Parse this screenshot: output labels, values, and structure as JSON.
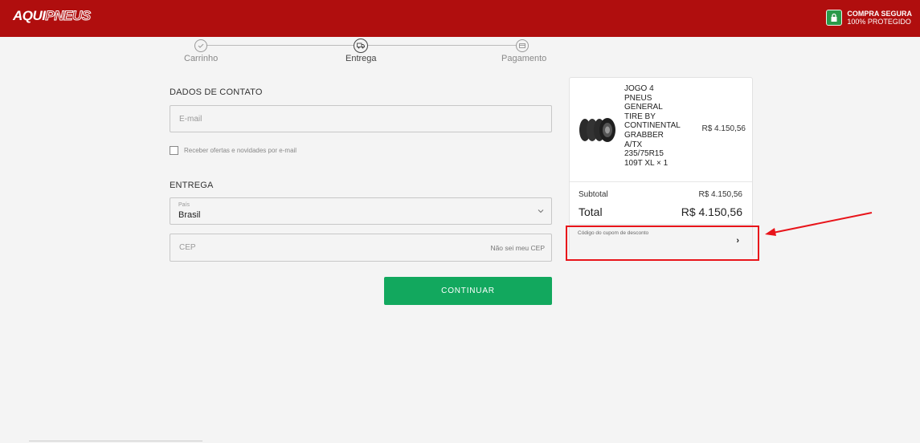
{
  "header": {
    "logo_part1": "AQUI",
    "logo_part2": "PNEUS",
    "secure_line1": "COMPRA SEGURA",
    "secure_line2": "100% PROTEGIDO"
  },
  "steps": [
    {
      "label": "Carrinho",
      "icon": "check-icon",
      "state": "done"
    },
    {
      "label": "Entrega",
      "icon": "truck-icon",
      "state": "active"
    },
    {
      "label": "Pagamento",
      "icon": "card-icon",
      "state": "pending"
    }
  ],
  "contact": {
    "title": "DADOS DE CONTATO",
    "email_placeholder": "E-mail",
    "newsletter_label": "Receber ofertas e novidades por e-mail"
  },
  "delivery": {
    "title": "ENTREGA",
    "country_label": "País",
    "country_value": "Brasil",
    "cep_placeholder": "CEP",
    "cep_help": "Não sei meu CEP"
  },
  "continue_label": "CONTINUAR",
  "summary": {
    "product_name": "JOGO 4\nPNEUS\nGENERAL\nTIRE BY\nCONTINENTAL\nGRABBER\nA/TX\n235/75R15\n109T XL × 1",
    "product_price": "R$ 4.150,56",
    "subtotal_label": "Subtotal",
    "subtotal_value": "R$ 4.150,56",
    "total_label": "Total",
    "total_value": "R$ 4.150,56",
    "coupon_label": "Código do cupom de desconto"
  },
  "colors": {
    "brand_red": "#b00e0e",
    "continue_green": "#12a85e",
    "annotation_red": "#e8141a"
  }
}
